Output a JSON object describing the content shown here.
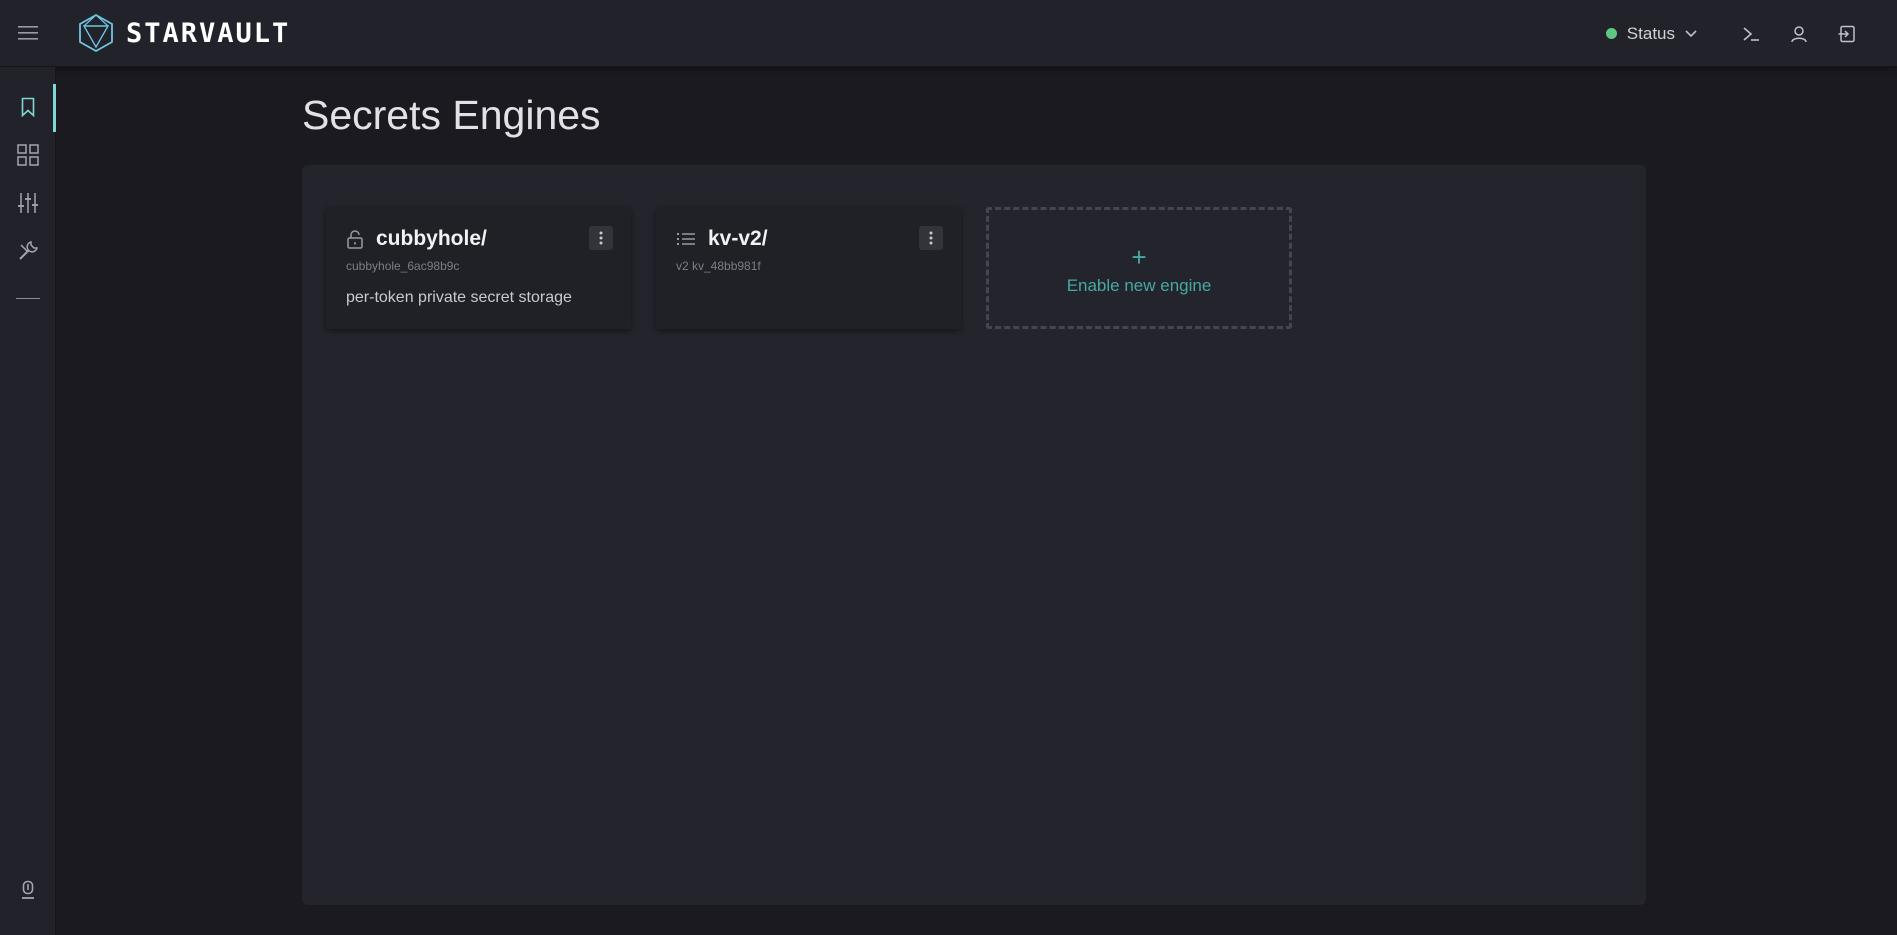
{
  "app": {
    "name": "STARVAULT",
    "icons": {
      "menu": "menu-icon",
      "logo": "polyhedron-logo"
    }
  },
  "header": {
    "status_label": "Status",
    "status_color": "#5fc783",
    "icons": [
      "terminal-icon",
      "user-icon",
      "logout-icon"
    ]
  },
  "sidebar": {
    "accent": "#7fd6d4",
    "items": [
      {
        "icon": "bookmark-icon",
        "active": true
      },
      {
        "icon": "grid-icon",
        "active": false
      },
      {
        "icon": "sliders-icon",
        "active": false
      },
      {
        "icon": "tools-icon",
        "active": false
      }
    ],
    "bottom_icon": "plug-icon"
  },
  "page": {
    "title": "Secrets Engines"
  },
  "engines": [
    {
      "name": "cubbyhole/",
      "icon": "unlock-icon",
      "accessor": "cubbyhole_6ac98b9c",
      "description": "per-token private secret storage"
    },
    {
      "name": "kv-v2/",
      "icon": "list-icon",
      "accessor": "v2 kv_48bb981f",
      "description": ""
    }
  ],
  "new_engine": {
    "plus": "+",
    "label": "Enable new engine"
  }
}
